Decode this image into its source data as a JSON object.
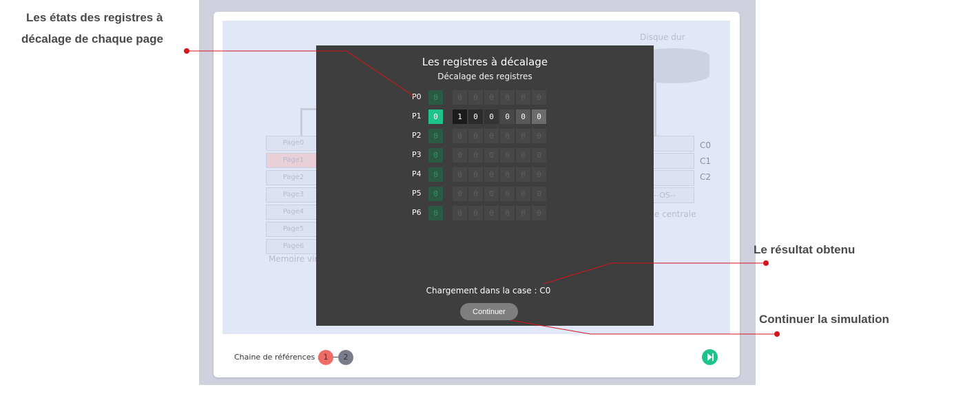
{
  "background": {
    "disk_label": "Disque dur",
    "virtual_memory_pages": [
      "Page0",
      "Page1",
      "Page2",
      "Page3",
      "Page4",
      "Page5",
      "Page6"
    ],
    "virtual_memory_label": "Memoire virt",
    "main_memory_slots": [
      "",
      "",
      "",
      "--OS--"
    ],
    "main_memory_labels": [
      "C0",
      "C1",
      "C2"
    ],
    "main_memory_label": "e centrale"
  },
  "modal": {
    "title": "Les registres à décalage",
    "subtitle": "Décalage des registres",
    "rows": [
      {
        "label": "P0",
        "ref": "0",
        "bits": [
          "0",
          "0",
          "0",
          "0",
          "0",
          "0"
        ],
        "active": false
      },
      {
        "label": "P1",
        "ref": "0",
        "bits": [
          "1",
          "0",
          "0",
          "0",
          "0",
          "0"
        ],
        "active": true
      },
      {
        "label": "P2",
        "ref": "0",
        "bits": [
          "0",
          "0",
          "0",
          "0",
          "0",
          "0"
        ],
        "active": false
      },
      {
        "label": "P3",
        "ref": "0",
        "bits": [
          "0",
          "0",
          "0",
          "0",
          "0",
          "0"
        ],
        "active": false
      },
      {
        "label": "P4",
        "ref": "0",
        "bits": [
          "0",
          "0",
          "0",
          "0",
          "0",
          "0"
        ],
        "active": false
      },
      {
        "label": "P5",
        "ref": "0",
        "bits": [
          "0",
          "0",
          "0",
          "0",
          "0",
          "0"
        ],
        "active": false
      },
      {
        "label": "P6",
        "ref": "0",
        "bits": [
          "0",
          "0",
          "0",
          "0",
          "0",
          "0"
        ],
        "active": false
      }
    ],
    "result": "Chargement dans la case : C0",
    "continue_label": "Continuer"
  },
  "footer": {
    "refs_label": "Chaine de références :",
    "refs": [
      "1",
      "2"
    ]
  },
  "annotations": {
    "registers_states": "Les états des registres à",
    "registers_states_line2": "décalage de chaque page",
    "result_obtained": "Le résultat obtenu",
    "continue_simulation": "Continuer la simulation"
  },
  "colors": {
    "accent_green": "#1ec38a",
    "annotation_red": "#d7141a",
    "chip_active": "#f06a66"
  }
}
